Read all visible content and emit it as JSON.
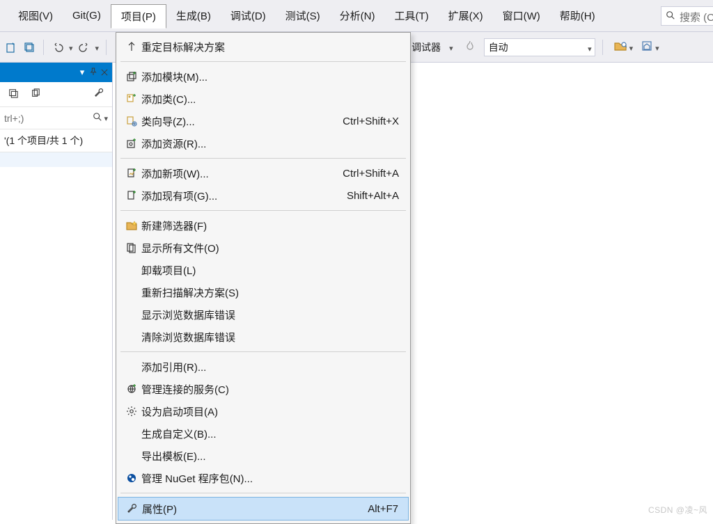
{
  "menubar": {
    "items": [
      {
        "label": "视图(V)"
      },
      {
        "label": "Git(G)"
      },
      {
        "label": "项目(P)",
        "open": true
      },
      {
        "label": "生成(B)"
      },
      {
        "label": "调试(D)"
      },
      {
        "label": "测试(S)"
      },
      {
        "label": "分析(N)"
      },
      {
        "label": "工具(T)"
      },
      {
        "label": "扩展(X)"
      },
      {
        "label": "窗口(W)"
      },
      {
        "label": "帮助(H)"
      }
    ],
    "search_placeholder": "搜索 (C"
  },
  "toolbar": {
    "debugger_label": "调试器",
    "auto_value": "自动"
  },
  "panel": {
    "header_caret": "▾",
    "search_placeholder": "trl+;)",
    "caption": "'(1 个项目/共 1 个)"
  },
  "menu": {
    "groups": [
      [
        {
          "icon": "arrow-up",
          "label": "重定目标解决方案",
          "shortcut": ""
        }
      ],
      [
        {
          "icon": "add-module",
          "label": "添加模块(M)...",
          "shortcut": ""
        },
        {
          "icon": "add-class",
          "label": "添加类(C)...",
          "shortcut": ""
        },
        {
          "icon": "class-wizard",
          "label": "类向导(Z)...",
          "shortcut": "Ctrl+Shift+X"
        },
        {
          "icon": "add-resource",
          "label": "添加资源(R)...",
          "shortcut": ""
        }
      ],
      [
        {
          "icon": "add-new",
          "label": "添加新项(W)...",
          "shortcut": "Ctrl+Shift+A"
        },
        {
          "icon": "add-existing",
          "label": "添加现有项(G)...",
          "shortcut": "Shift+Alt+A"
        }
      ],
      [
        {
          "icon": "new-filter",
          "label": "新建筛选器(F)",
          "shortcut": ""
        },
        {
          "icon": "show-all",
          "label": "显示所有文件(O)",
          "shortcut": ""
        },
        {
          "icon": "",
          "label": "卸载项目(L)",
          "shortcut": ""
        },
        {
          "icon": "",
          "label": "重新扫描解决方案(S)",
          "shortcut": ""
        },
        {
          "icon": "",
          "label": "显示浏览数据库错误",
          "shortcut": ""
        },
        {
          "icon": "",
          "label": "清除浏览数据库错误",
          "shortcut": ""
        }
      ],
      [
        {
          "icon": "",
          "label": "添加引用(R)...",
          "shortcut": ""
        },
        {
          "icon": "connected",
          "label": "管理连接的服务(C)",
          "shortcut": ""
        },
        {
          "icon": "gear",
          "label": "设为启动项目(A)",
          "shortcut": ""
        },
        {
          "icon": "",
          "label": "生成自定义(B)...",
          "shortcut": ""
        },
        {
          "icon": "",
          "label": "导出模板(E)...",
          "shortcut": ""
        },
        {
          "icon": "nuget",
          "label": "管理 NuGet 程序包(N)...",
          "shortcut": ""
        }
      ],
      [
        {
          "icon": "wrench",
          "label": "属性(P)",
          "shortcut": "Alt+F7",
          "highlight": true
        }
      ]
    ]
  },
  "watermark": "CSDN @凌~风"
}
